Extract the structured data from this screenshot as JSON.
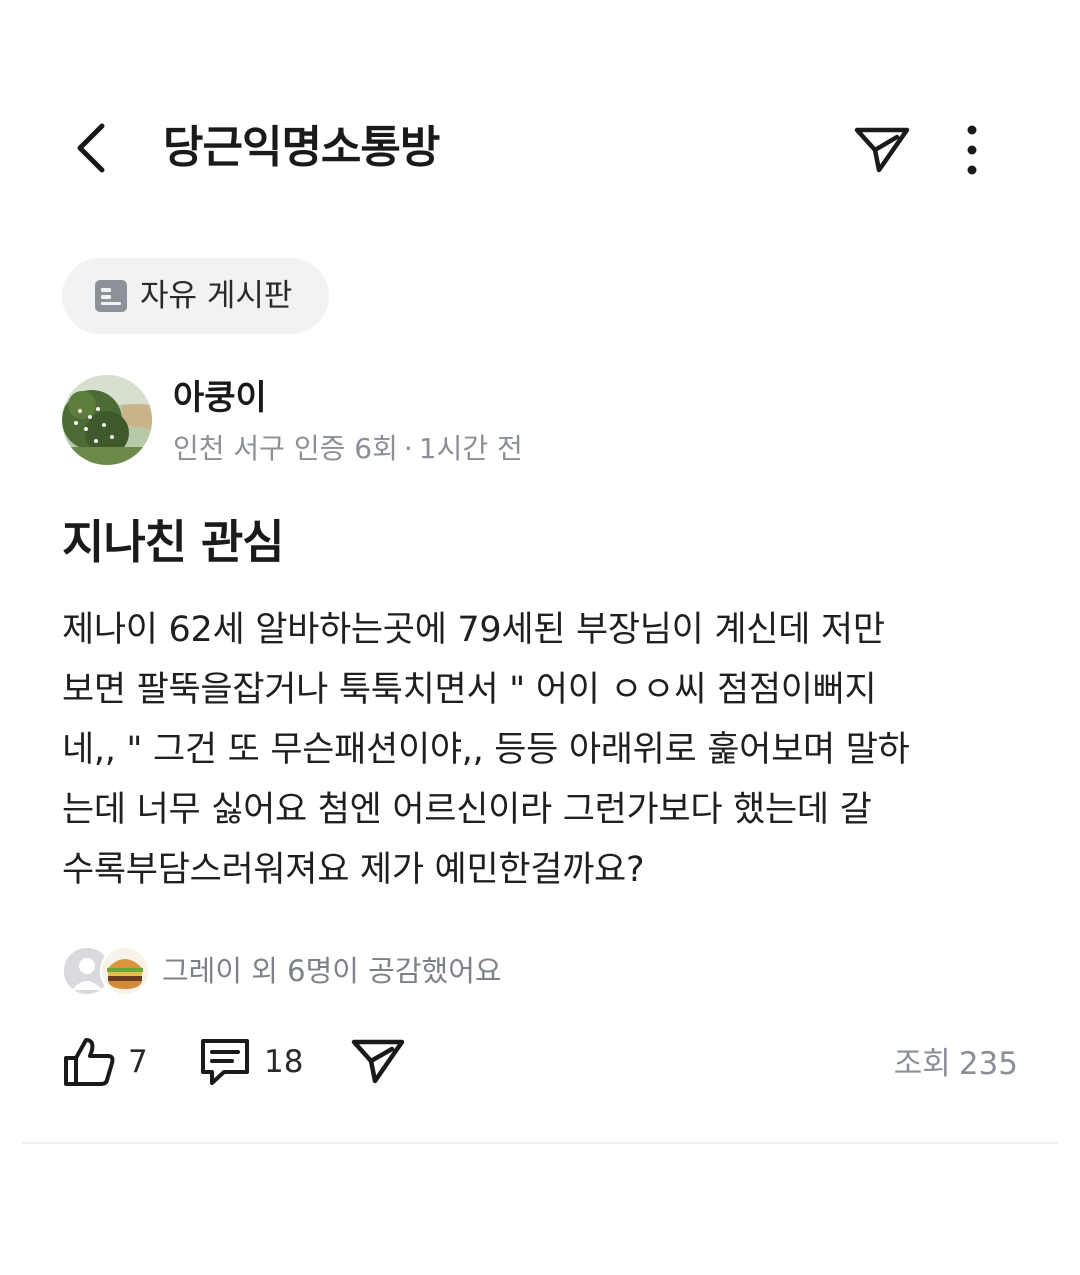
{
  "header": {
    "title": "당근익명소통방",
    "back_icon": "chevron-left-icon",
    "share_icon": "paper-plane-icon",
    "more_icon": "vertical-dots-icon"
  },
  "board": {
    "label": "자유 게시판",
    "icon": "board-icon"
  },
  "author": {
    "name": "아쿵이",
    "location": "인천 서구 인증 6회",
    "separator": "·",
    "time": "1시간 전"
  },
  "post": {
    "title": "지나친 관심",
    "body": "제나이 62세 알바하는곳에 79세된 부장님이 계신데 저만\n보면 팔뚝을잡거나 툭툭치면서  \" 어이 ㅇㅇ씨 점점이뻐지\n네,,  \" 그건 또 무슨패션이야,, 등등 아래위로 훑어보며 말하\n는데 너무 싫어요 첨엔 어르신이라  그런가보다 했는데 갈\n수록부담스러워져요 제가 예민한걸까요?"
  },
  "reactions": {
    "text": "그레이 외 6명이 공감했어요"
  },
  "actions": {
    "like_count": "7",
    "comment_count": "18",
    "view_label": "조회",
    "view_count": "235"
  },
  "colors": {
    "text_primary": "#1a1a1a",
    "text_secondary": "#8b8f96",
    "chip_bg": "#f1f2f4"
  }
}
